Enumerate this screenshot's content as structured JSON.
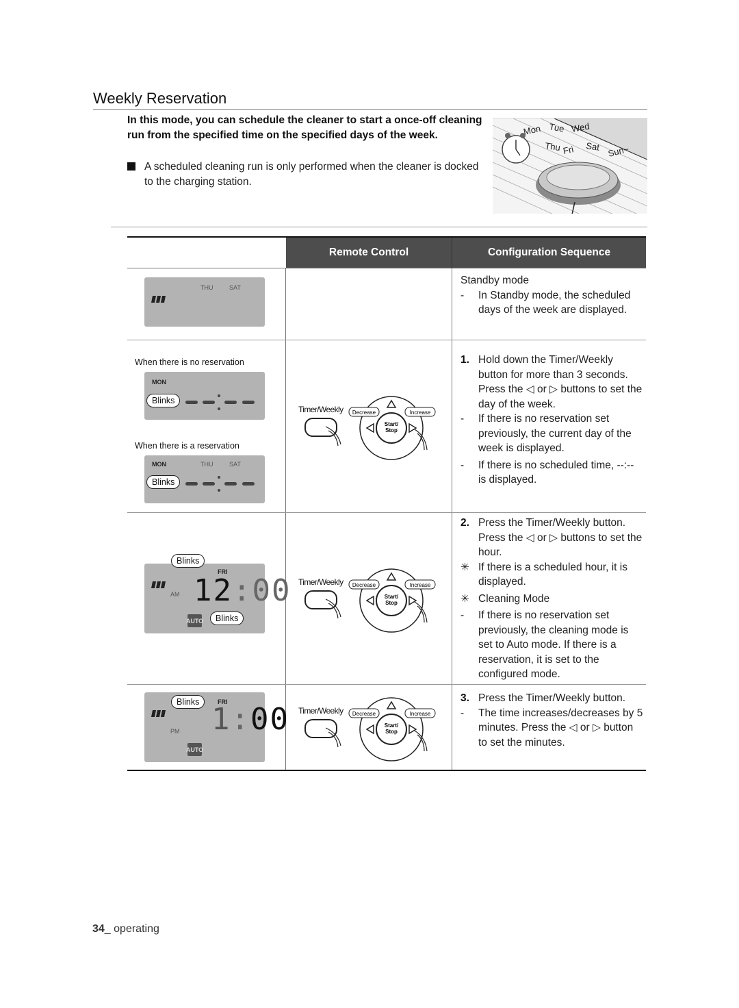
{
  "section_title": "Weekly Reservation",
  "intro_text": "In this mode, you can schedule the cleaner to start a once-off cleaning run from the specified time on the specified days of the week.",
  "note_text": "A scheduled cleaning run is only performed when the cleaner is docked to the charging station.",
  "illustration": {
    "days": [
      "Mon",
      "Tue",
      "Wed",
      "Thu",
      "Fri",
      "Sat",
      "Sun~"
    ]
  },
  "table": {
    "headers": [
      "",
      "Remote Control",
      "Configuration Sequence"
    ],
    "rows": [
      {
        "display": {
          "days": [
            "THU",
            "SAT"
          ]
        },
        "config": {
          "lead": "Standby mode",
          "items": [
            {
              "marker": "-",
              "text": "In Standby mode, the scheduled days of the week are displayed."
            }
          ]
        }
      },
      {
        "captions": [
          "When there is no reservation",
          "When there is a reservation"
        ],
        "display_a": {
          "day": "MON",
          "bubble": "Blinks",
          "time": "--:--"
        },
        "display_b": {
          "day": "MON",
          "days": [
            "THU",
            "SAT"
          ],
          "bubble": "Blinks",
          "time": "--:--"
        },
        "remote": {
          "timer_label": "Timer/Weekly",
          "decrease": "Decrease",
          "increase": "Increase",
          "start_stop": "Start/\nStop"
        },
        "config": {
          "step": "1.",
          "step_text": "Hold down the Timer/Weekly button for more than 3 seconds. Press the ◁ or ▷ buttons to set the day of the week.",
          "items": [
            {
              "marker": "-",
              "text": "If there is no reservation set previously, the current day of the week is displayed."
            },
            {
              "marker": "-",
              "text": "If there is no scheduled time, --:-- is displayed."
            }
          ]
        }
      },
      {
        "display": {
          "day": "FRI",
          "bubble_top": "Blinks",
          "bubble_bottom": "Blinks",
          "ampm": "AM",
          "hour": "12",
          "minute": "00",
          "mode": "AUTO"
        },
        "remote": {
          "timer_label": "Timer/Weekly",
          "decrease": "Decrease",
          "increase": "Increase",
          "start_stop": "Start/\nStop"
        },
        "config": {
          "step": "2.",
          "step_text": "Press the Timer/Weekly button. Press the ◁ or ▷ buttons to set the hour.",
          "items": [
            {
              "marker": "✳",
              "text": "If there is a scheduled hour, it is displayed."
            },
            {
              "marker": "✳",
              "text": "Cleaning Mode"
            },
            {
              "marker": "-",
              "text": "If there is no reservation set previously, the cleaning mode is set to Auto mode. If there is a reservation, it is set to the configured mode."
            }
          ]
        }
      },
      {
        "display": {
          "day": "FRI",
          "bubble_top": "Blinks",
          "ampm": "PM",
          "hour": "1",
          "minute": "00",
          "mode": "AUTO"
        },
        "remote": {
          "timer_label": "Timer/Weekly",
          "decrease": "Decrease",
          "increase": "Increase",
          "start_stop": "Start/\nStop"
        },
        "config": {
          "step": "3.",
          "step_text": "Press the Timer/Weekly button.",
          "items": [
            {
              "marker": "-",
              "text": "The time increases/decreases by 5 minutes. Press the ◁ or ▷ button to set the minutes."
            }
          ]
        }
      }
    ]
  },
  "footer": {
    "page_number": "34",
    "section": "operating"
  }
}
